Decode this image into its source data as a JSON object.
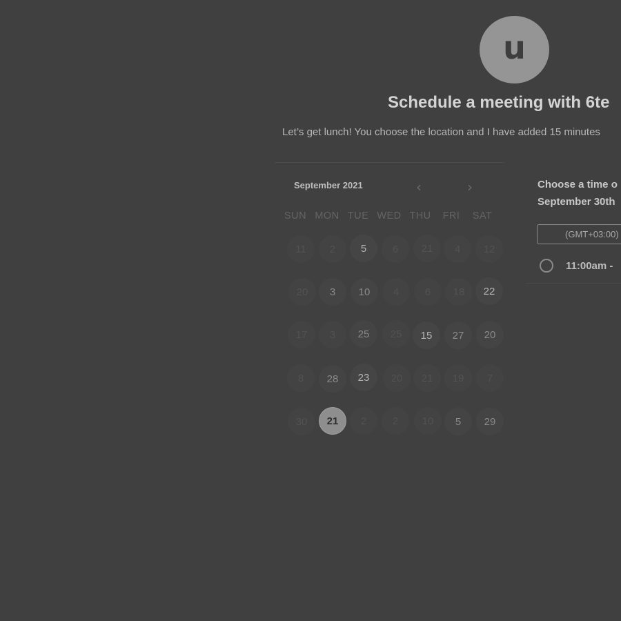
{
  "avatar": {
    "initial": "u"
  },
  "header": {
    "title": "Schedule a meeting with 6te",
    "subtitle": "Let’s get lunch! You choose the location and I have added 15 minutes"
  },
  "calendar": {
    "month_label": "September 2021",
    "prev_icon": "‹",
    "next_icon": "›",
    "weekdays": [
      "SUN",
      "MON",
      "TUE",
      "WED",
      "THU",
      "FRI",
      "SAT"
    ],
    "weeks": [
      [
        "11",
        "2",
        "5",
        "6",
        "21",
        "4",
        "12"
      ],
      [
        "20",
        "3",
        "10",
        "4",
        "6",
        "18",
        "22"
      ],
      [
        "17",
        "3",
        "25",
        "25",
        "15",
        "27",
        "20"
      ],
      [
        "8",
        "28",
        "23",
        "20",
        "21",
        "19",
        "7"
      ],
      [
        "30",
        "21",
        "2",
        "2",
        "10",
        "5",
        "29"
      ]
    ],
    "selected_day": "21"
  },
  "times": {
    "heading_line1": "Choose a time o",
    "heading_line2": "September 30th",
    "timezone": "(GMT+03:00)",
    "slots": [
      {
        "label": "11:00am -"
      }
    ]
  }
}
